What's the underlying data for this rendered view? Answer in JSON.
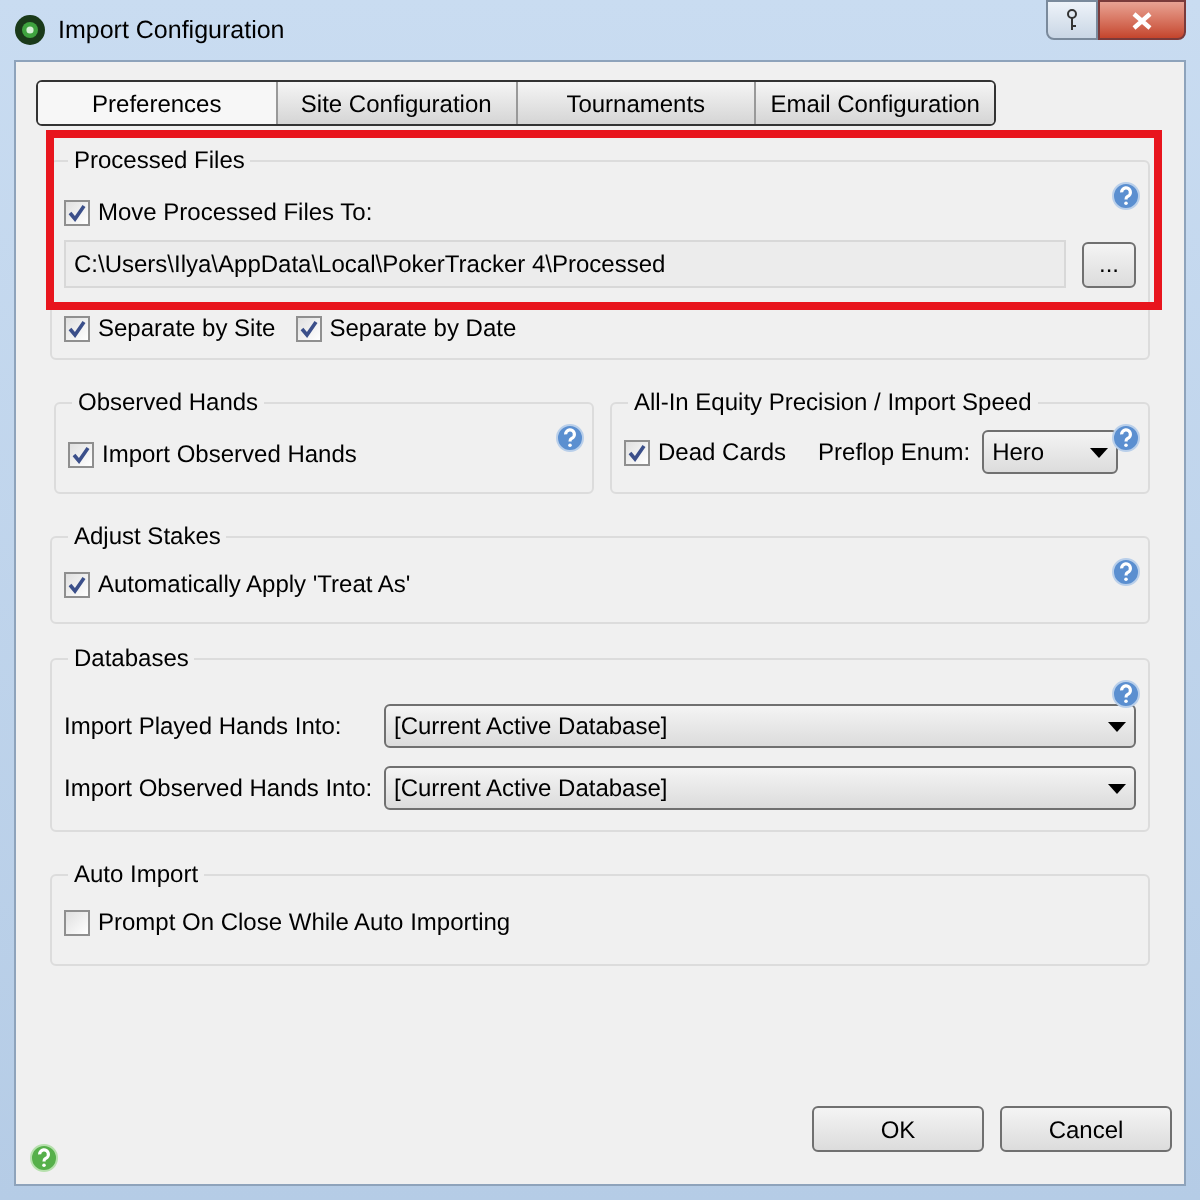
{
  "window": {
    "title": "Import Configuration"
  },
  "tabs": [
    {
      "label": "Preferences",
      "selected": true
    },
    {
      "label": "Site Configuration",
      "selected": false
    },
    {
      "label": "Tournaments",
      "selected": false
    },
    {
      "label": "Email Configuration",
      "selected": false
    }
  ],
  "processed_files": {
    "title": "Processed Files",
    "highlighted": true,
    "move": {
      "label": "Move Processed Files To:",
      "checked": true
    },
    "path": {
      "value": "C:\\Users\\Ilya\\AppData\\Local\\PokerTracker 4\\Processed"
    },
    "browse_button": "...",
    "options": [
      {
        "label": "Separate by Site",
        "checked": true
      },
      {
        "label": "Separate by Date",
        "checked": true
      }
    ]
  },
  "observed_hands": {
    "title": "Observed Hands",
    "import": {
      "label": "Import Observed Hands",
      "checked": true
    }
  },
  "all_in_equity": {
    "title": "All-In Equity Precision / Import Speed",
    "dead_cards": {
      "label": "Dead Cards",
      "checked": true
    },
    "preflop_enum": {
      "label": "Preflop Enum:",
      "value": "Hero"
    }
  },
  "adjust_stakes": {
    "title": "Adjust Stakes",
    "treat_as": {
      "label": "Automatically Apply 'Treat As'",
      "checked": true
    }
  },
  "databases": {
    "title": "Databases",
    "rows": [
      {
        "label": "Import Played Hands Into:",
        "value": "[Current Active Database]"
      },
      {
        "label": "Import Observed Hands Into:",
        "value": "[Current Active Database]"
      }
    ]
  },
  "auto_import": {
    "title": "Auto Import",
    "prompt": {
      "label": "Prompt On Close While Auto Importing",
      "checked": false
    }
  },
  "buttons": [
    "OK",
    "Cancel"
  ]
}
